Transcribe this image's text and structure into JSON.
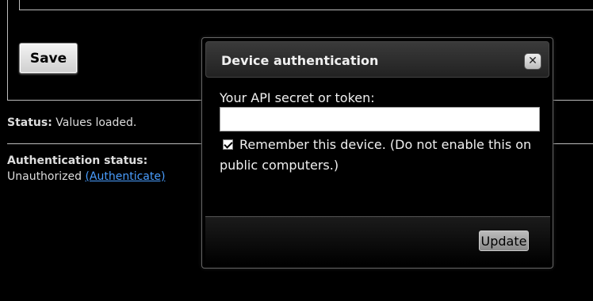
{
  "page": {
    "save_label": "Save",
    "status_label": "Status:",
    "status_value": "Values loaded.",
    "auth_status_label": "Authentication status:",
    "auth_status_value": "Unauthorized",
    "auth_link_label": "(Authenticate)"
  },
  "modal": {
    "title": "Device authentication",
    "close_icon": "close-icon",
    "field_label": "Your API secret or token:",
    "token_value": "",
    "remember_checked": true,
    "remember_label": "Remember this device. (Do not enable this on public computers.)",
    "update_label": "Update"
  },
  "colors": {
    "background": "#000000",
    "link": "#4a9eff",
    "border": "#bdbdbd"
  }
}
